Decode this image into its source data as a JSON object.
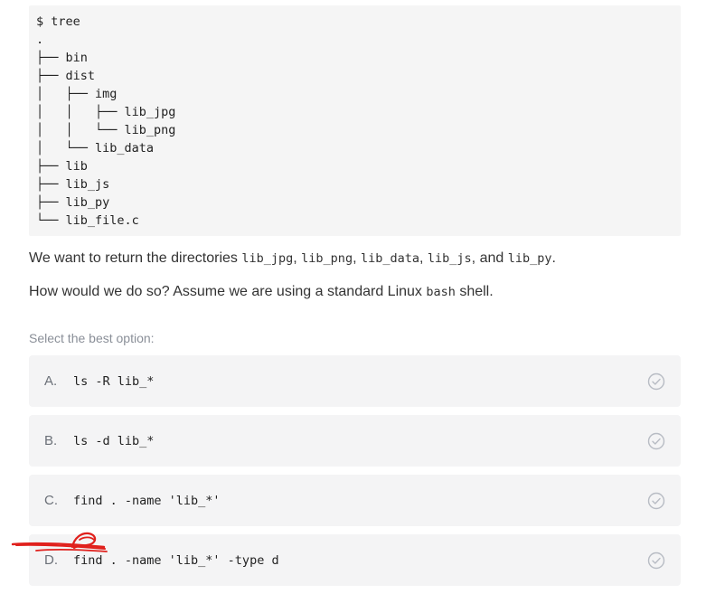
{
  "code_block": {
    "lines": [
      "$ tree",
      ".",
      "├── bin",
      "├── dist",
      "│   ├── img",
      "│   │   ├── lib_jpg",
      "│   │   └── lib_png",
      "│   └── lib_data",
      "├── lib",
      "├── lib_js",
      "├── lib_py",
      "└── lib_file.c"
    ]
  },
  "question": {
    "line1": {
      "prefix": "We want to return the directories ",
      "items": [
        "lib_jpg",
        "lib_png",
        "lib_data",
        "lib_js",
        "lib_py"
      ],
      "sep1": ", ",
      "sep2": ", ",
      "sep3": ", ",
      "sep4": ", and ",
      "suffix": "."
    },
    "line2": {
      "prefix": "How would we do so? Assume we are using a standard Linux ",
      "code": "bash",
      "suffix": " shell."
    }
  },
  "select_label": "Select the best option:",
  "options": [
    {
      "letter": "A.",
      "command": "ls -R lib_*"
    },
    {
      "letter": "B.",
      "command": "ls -d lib_*"
    },
    {
      "letter": "C.",
      "command": "find . -name 'lib_*'"
    },
    {
      "letter": "D.",
      "command": "find . -name 'lib_*' -type d"
    }
  ],
  "colors": {
    "option_bg": "#f4f4f5",
    "check_icon": "#b8bcc4",
    "scribble": "#e0201c"
  }
}
